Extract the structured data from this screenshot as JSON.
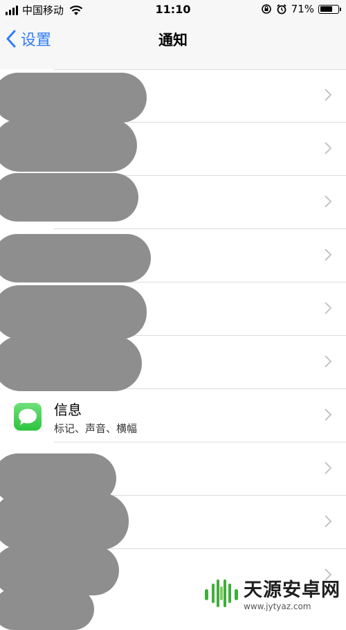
{
  "statusbar": {
    "carrier": "中国移动",
    "time": "11:10",
    "battery_percent": "71%",
    "battery_level": 0.71
  },
  "navbar": {
    "back_label": "设置",
    "title": "通知"
  },
  "messages_row": {
    "title": "信息",
    "subtitle": "标记、声音、横幅"
  },
  "watermark": {
    "name": "天源安卓网",
    "url": "www.jytyaz.com"
  },
  "colors": {
    "accent": "#2f7cf6",
    "messages_icon": "#3cc84a",
    "redaction": "#8e8e8e"
  }
}
